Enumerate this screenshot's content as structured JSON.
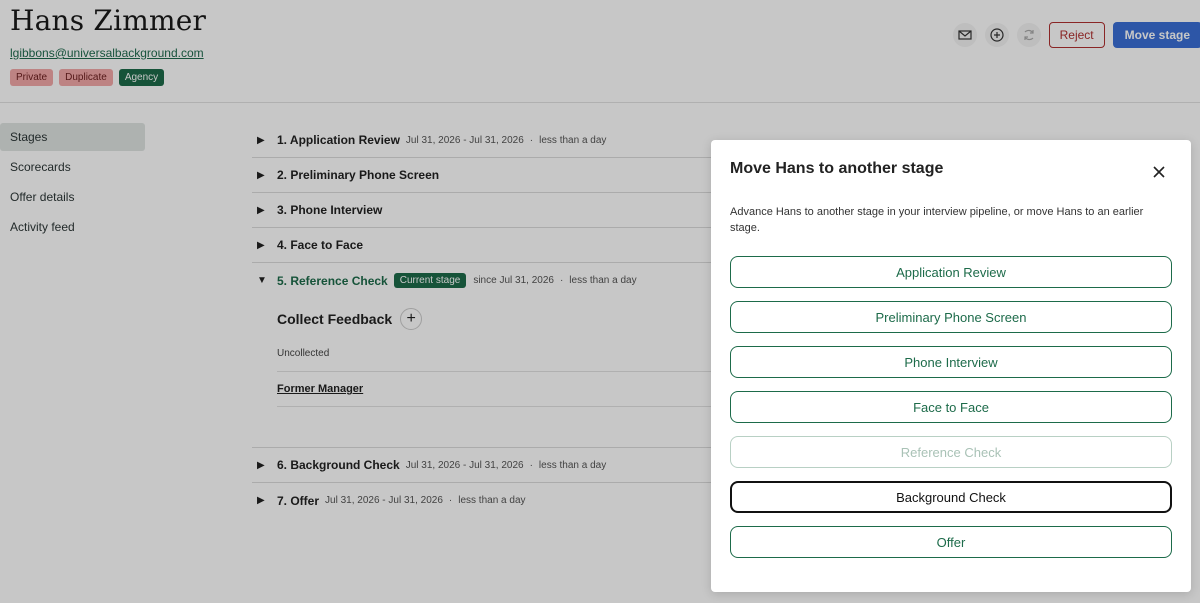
{
  "candidate": {
    "name": "Hans Zimmer",
    "email": "lgibbons@universalbackground.com",
    "badges": [
      "Private",
      "Duplicate",
      "Agency"
    ]
  },
  "header_actions": {
    "mail_icon": "mail-icon",
    "add_icon": "plus-circle-icon",
    "refresh_icon": "refresh-icon",
    "reject_label": "Reject",
    "move_label": "Move stage"
  },
  "side_nav": {
    "items": [
      "Stages",
      "Scorecards",
      "Offer details",
      "Activity feed"
    ],
    "active": "Stages"
  },
  "stages": [
    {
      "title": "1. Application Review",
      "dates": "Jul 31, 2026 - Jul 31, 2026",
      "duration": "less than a day"
    },
    {
      "title": "2. Preliminary Phone Screen",
      "dates": "",
      "duration": ""
    },
    {
      "title": "3. Phone Interview",
      "dates": "",
      "duration": ""
    },
    {
      "title": "4. Face to Face",
      "dates": "",
      "duration": ""
    },
    {
      "title": "5. Reference Check",
      "tag": "Current stage",
      "dates": "since Jul 31, 2026",
      "duration": "less than a day"
    },
    {
      "title": "6. Background Check",
      "dates": "Jul 31, 2026 - Jul 31, 2026",
      "duration": "less than a day"
    },
    {
      "title": "7. Offer",
      "dates": "Jul 31, 2026 - Jul 31, 2026",
      "duration": "less than a day"
    }
  ],
  "feedback": {
    "title": "Collect Feedback",
    "status": "Uncollected",
    "reviewer": "Former Manager"
  },
  "modal": {
    "title": "Move Hans to another stage",
    "description": "Advance Hans to another stage in your interview pipeline, or move Hans to an earlier stage.",
    "options": [
      "Application Review",
      "Preliminary Phone Screen",
      "Phone Interview",
      "Face to Face",
      "Reference Check",
      "Background Check",
      "Offer"
    ],
    "disabled_option": "Reference Check",
    "focused_option": "Background Check"
  },
  "colors": {
    "brand_green": "#1d6b4a",
    "primary_blue": "#3a6fd6",
    "reject_red": "#b03030"
  }
}
